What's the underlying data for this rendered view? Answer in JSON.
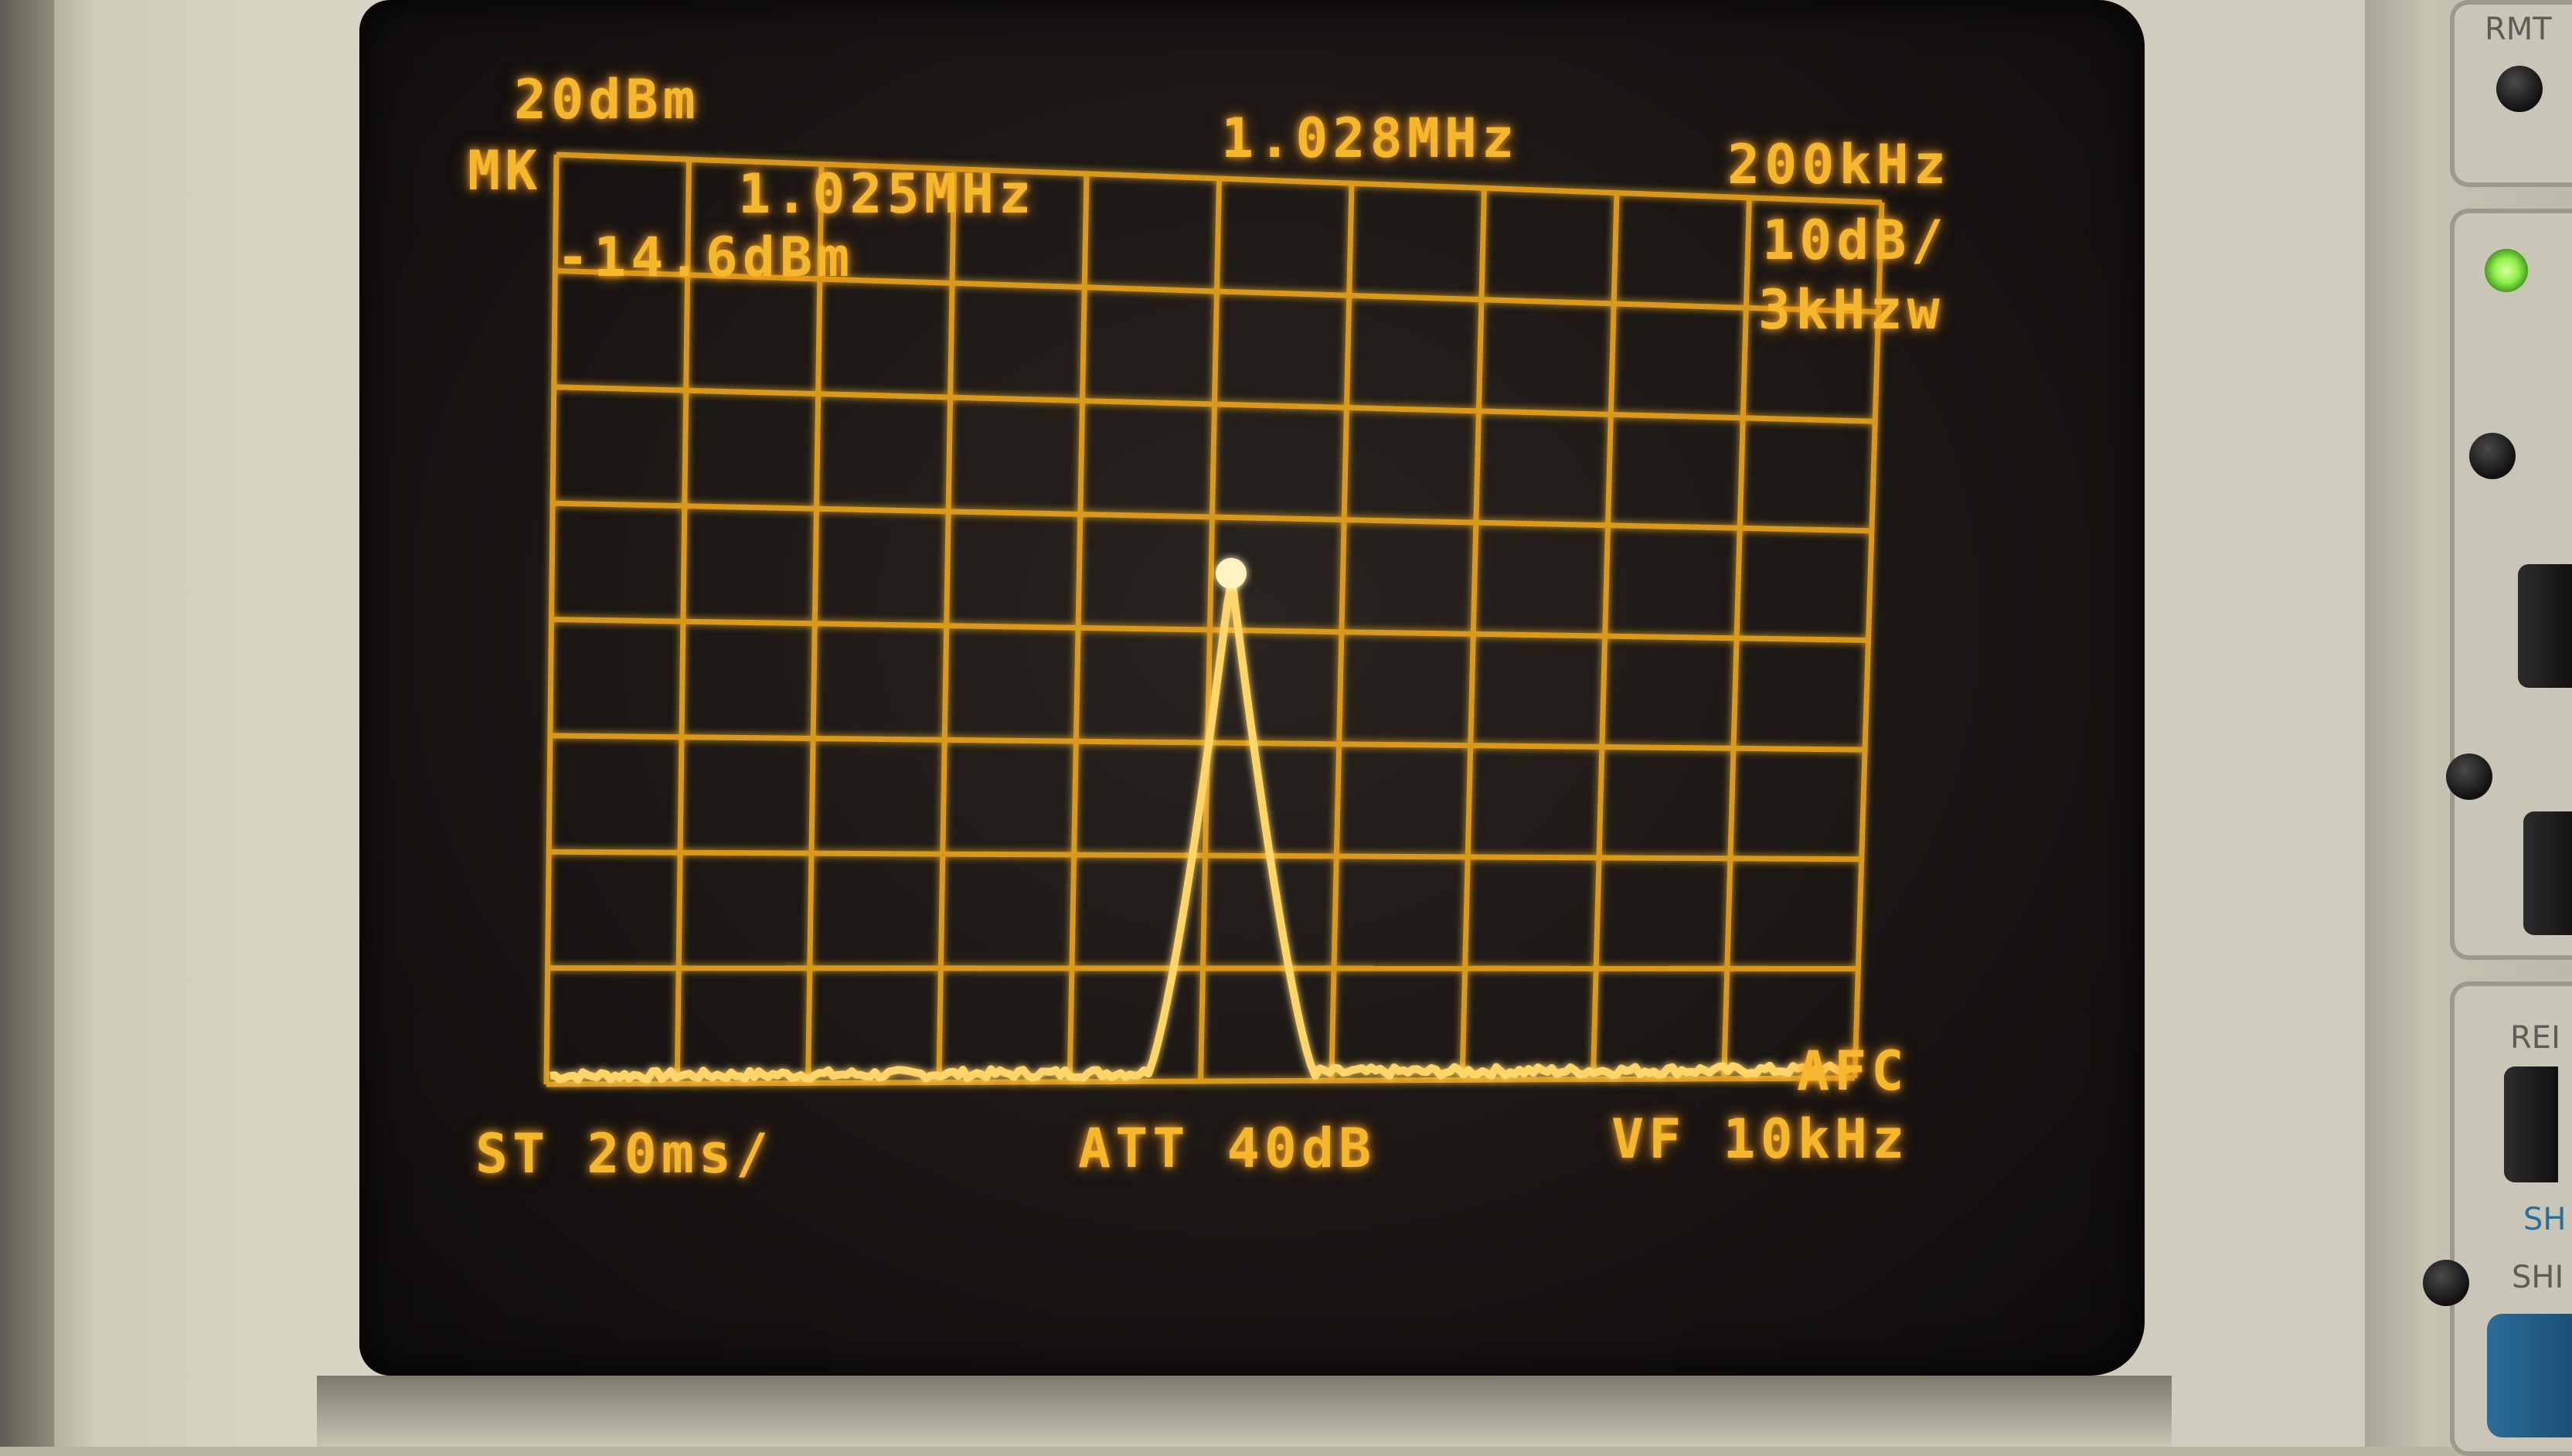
{
  "screen": {
    "ref_level": "20dBm",
    "marker_label": "MK",
    "marker_freq": "1.025MHz",
    "marker_level": "-14.6dBm",
    "center_freq": "1.028MHz",
    "span": "200kHz",
    "scale": "10dB/",
    "rbw": "3kHzw",
    "afc": "AFC",
    "sweep_time": "ST 20ms/",
    "attenuation": "ATT 40dB",
    "video_filter": "VF 10kHz"
  },
  "panel": {
    "rmt_label": "RMT",
    "ref_label": "REI",
    "shift_label": "SHI",
    "blue_label": "SH"
  },
  "colors": {
    "trace": "#f5b72c",
    "led": "#8ef04a"
  }
}
